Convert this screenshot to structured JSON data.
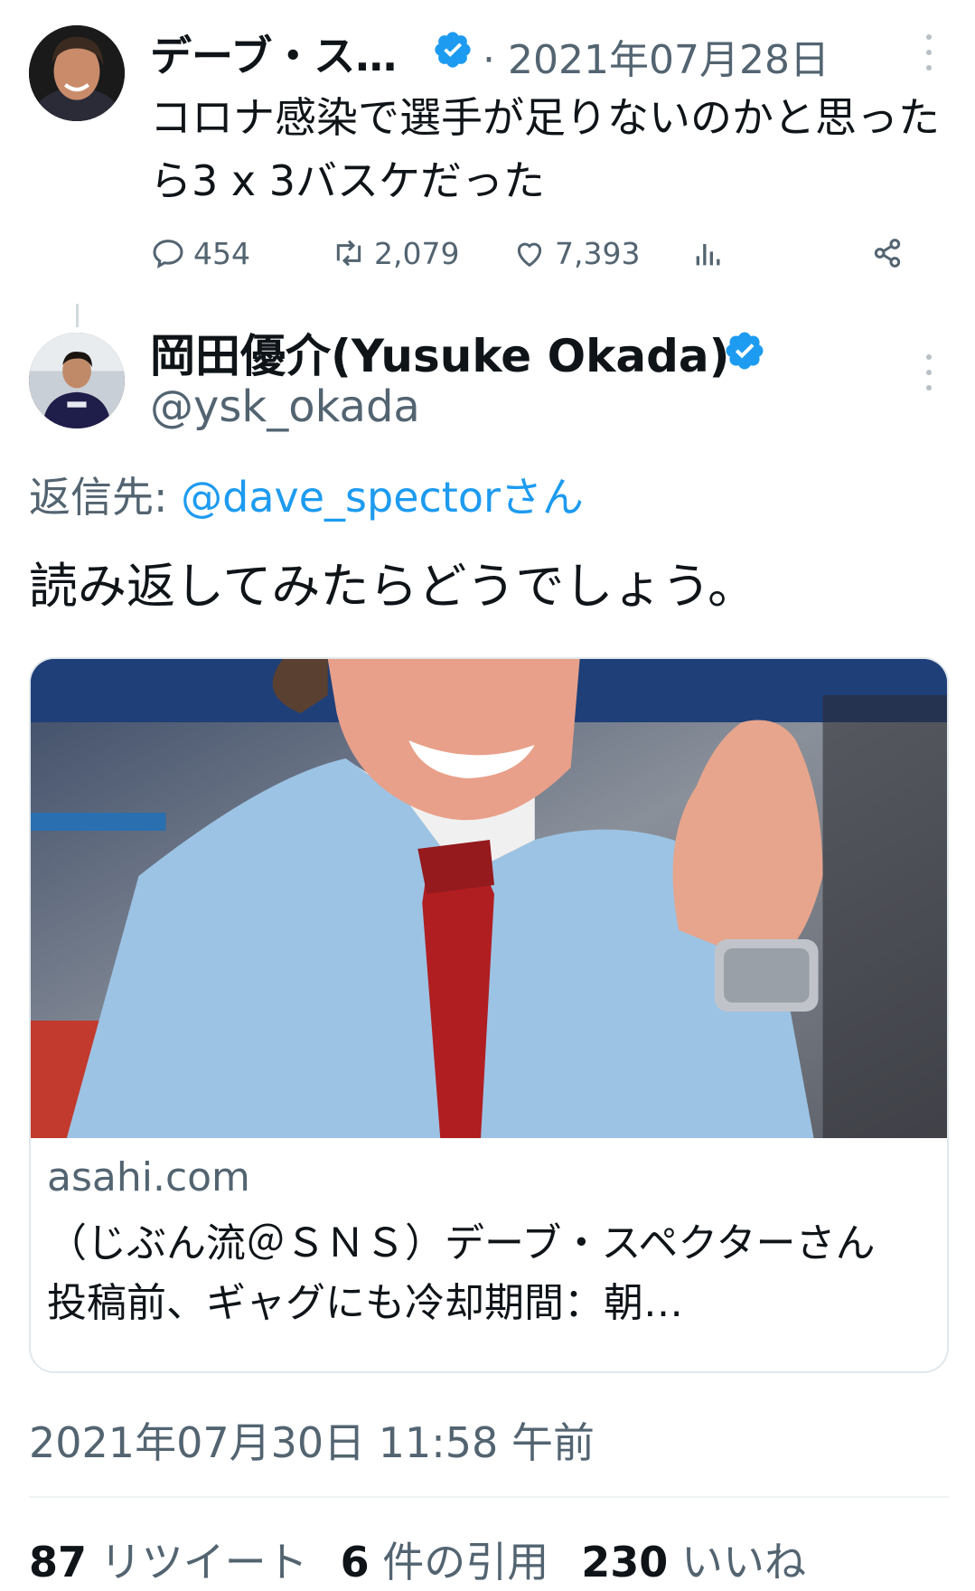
{
  "parent_tweet": {
    "display_name": "デーブ・ス…",
    "separator": "·",
    "date": "2021年07月28日",
    "text": "コロナ感染で選手が足りないのかと思ったら3 x 3バスケだった",
    "replies": "454",
    "retweets": "2,079",
    "likes": "7,393",
    "icons": [
      "reply-icon",
      "retweet-icon",
      "like-icon",
      "views-icon",
      "share-icon"
    ]
  },
  "main_tweet": {
    "display_name": "岡田優介(Yusuke Okada)",
    "handle": "@ysk_okada",
    "reply_prefix": "返信先: ",
    "reply_target": "@dave_spectorさん",
    "text": "読み返してみたらどうでしょう。",
    "card": {
      "domain": "asahi.com",
      "title": "（じぶん流＠ＳＮＳ）デーブ・スペクターさん　投稿前、ギャグにも冷却期間：朝…"
    },
    "timestamp": "2021年07月30日 11:58 午前",
    "stats": {
      "retweets_count": "87",
      "retweets_label": "リツイート",
      "quotes_count": "6",
      "quotes_label": "件の引用",
      "likes_count": "230",
      "likes_label": "いいね"
    }
  },
  "colors": {
    "accent": "#1d9bf0",
    "text": "#0f1419",
    "muted": "#536471"
  }
}
